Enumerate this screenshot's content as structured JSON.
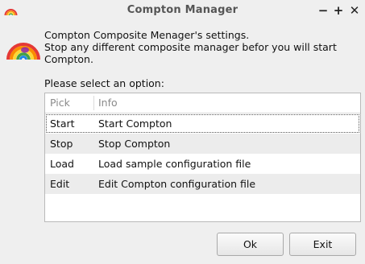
{
  "window": {
    "title": "Compton Manager",
    "controls": {
      "minimize": "−",
      "maximize": "+",
      "close": "✕"
    }
  },
  "message": {
    "lines": [
      "Compton Composite Menager's settings.",
      "Stop any different composite manager befor you will start",
      "Compton."
    ]
  },
  "prompt": "Please select an option:",
  "list": {
    "columns": [
      "Pick",
      "Info"
    ],
    "rows": [
      {
        "pick": "Start",
        "info": "Start Compton",
        "selected": true
      },
      {
        "pick": "Stop",
        "info": "Stop Compton",
        "selected": false
      },
      {
        "pick": "Load",
        "info": "Load sample configuration file",
        "selected": false
      },
      {
        "pick": "Edit",
        "info": "Edit Compton configuration file",
        "selected": false
      }
    ]
  },
  "buttons": {
    "ok": "Ok",
    "exit": "Exit"
  },
  "icons": {
    "app": "rainbow-icon",
    "dialog": "rainbow-icon"
  },
  "colors": {
    "background": "#efefef",
    "list_bg": "#ffffff",
    "alt_row": "#ececec",
    "header_text": "#8a8a8a"
  }
}
